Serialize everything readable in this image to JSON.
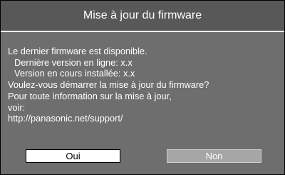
{
  "dialog": {
    "title": "Mise à jour du firmware",
    "lines": [
      "Le dernier firmware est disponible.",
      "Dernière version en ligne: x.x",
      "Version en cours installée: x.x",
      "Voulez-vous démarrer la mise à jour du firmware?",
      "Pour toute information sur la mise à jour,",
      "voir:",
      "http://panasonic.net/support/"
    ],
    "buttons": {
      "yes": "Oui",
      "no": "Non"
    },
    "colors": {
      "background": "#6e6e6e",
      "titlebar": "#585858",
      "text": "#ffffff",
      "button_yes_bg": "#ffffff",
      "button_no_bg": "#a6a6a6"
    }
  }
}
